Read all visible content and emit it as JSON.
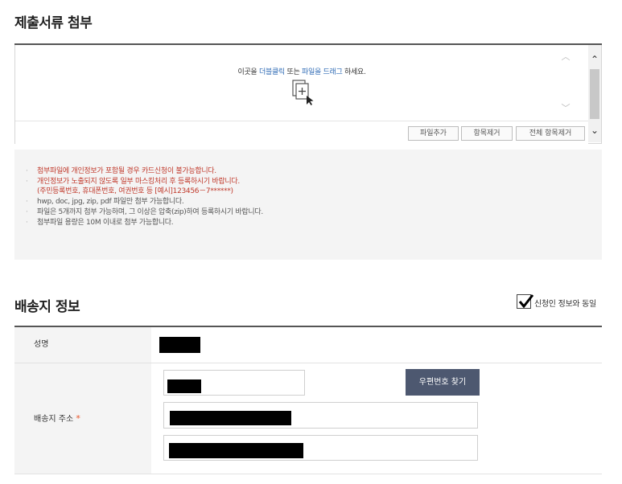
{
  "attach": {
    "title": "제출서류 첨부",
    "drop_prefix": "이곳을 ",
    "drop_dblclick": "더블클릭",
    "drop_mid": " 또는 ",
    "drop_drag": "파일을 드래그",
    "drop_suffix": " 하세요.",
    "btn_add": "파일추가",
    "btn_remove": "항목제거",
    "btn_remove_all": "전체 항목제거"
  },
  "notice": {
    "items": [
      "첨부파일에 개인정보가 포함될 경우 카드신청이 불가능합니다.",
      "개인정보가 노출되지 않도록 일부 마스킹처리 후 등록하시기 바랍니다.",
      "(주민등록번호, 휴대폰번호, 여권번호 등 [예시]123456－7******)",
      "hwp, doc, jpg, zip, pdf 파일만 첨부 가능합니다.",
      "파일은 5개까지 첨부 가능하며, 그 이상은 압축(zip)하여 등록하시기 바랍니다.",
      "첨부파일 용량은 10M 이내로 첨부 가능합니다."
    ]
  },
  "shipping": {
    "title": "배송지 정보",
    "same_as_applicant_label": "신청인 정보와 동일",
    "same_as_applicant_checked": true,
    "name_label": "성명",
    "address_label": "배송지 주소",
    "required_mark": "*",
    "zip_button": "우편번호 찾기"
  }
}
